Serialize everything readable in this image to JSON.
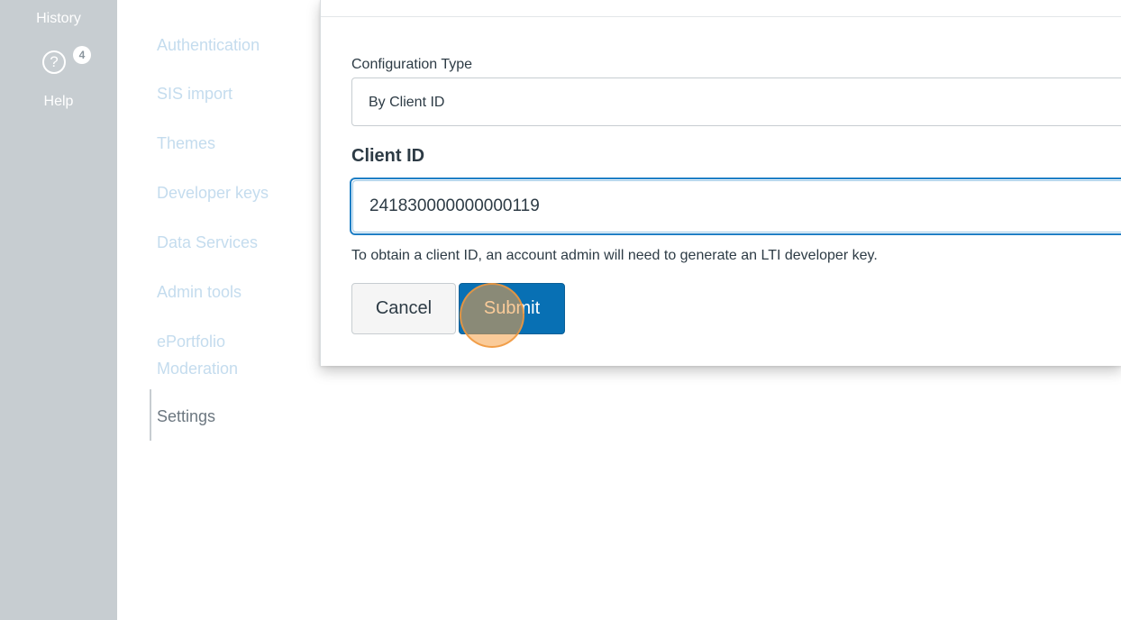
{
  "global_nav": {
    "history_label": "History",
    "help_label": "Help",
    "help_icon_glyph": "?",
    "help_badge_count": "4"
  },
  "account_nav": {
    "items": [
      {
        "label": "Authentication"
      },
      {
        "label": "SIS import"
      },
      {
        "label": "Themes"
      },
      {
        "label": "Developer keys"
      },
      {
        "label": "Data Services"
      },
      {
        "label": "Admin tools"
      },
      {
        "label": "ePortfolio Moderation"
      },
      {
        "label": "Settings"
      }
    ],
    "active_item": "Settings",
    "link_color": "#c4dcee",
    "active_color": "#6c7780"
  },
  "dialog": {
    "configuration_type_label": "Configuration Type",
    "configuration_type_value": "By Client ID",
    "client_id_label": "Client ID",
    "client_id_value": "241830000000000119",
    "hint": "To obtain a client ID, an account admin will need to generate an LTI developer key.",
    "cancel_label": "Cancel",
    "submit_label": "Submit",
    "submit_color": "#0870b4",
    "focus_color": "#1f7fc5"
  },
  "click_indicator_color": "#f5a046"
}
